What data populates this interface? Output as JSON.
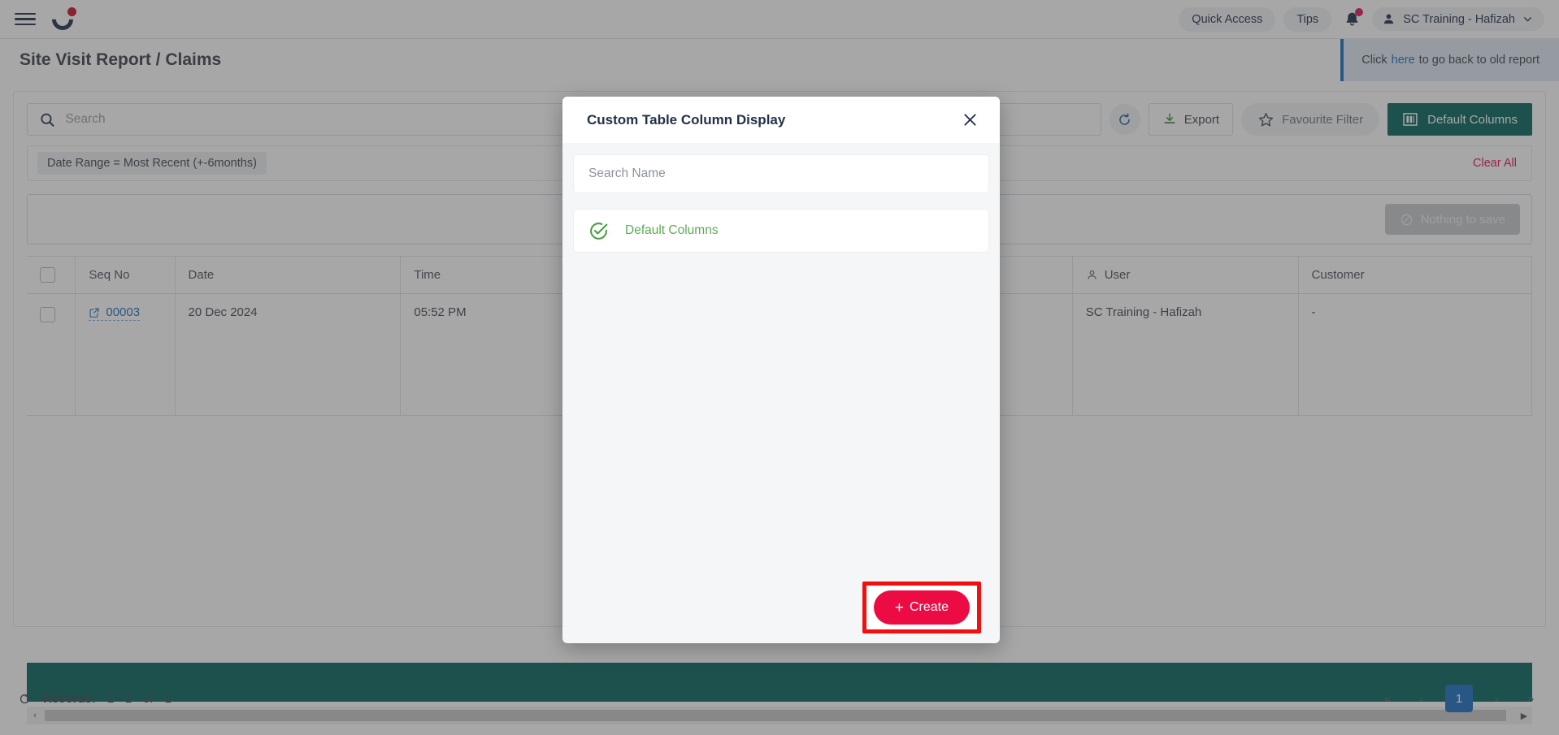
{
  "appbar": {
    "menu_icon": "hamburger-menu-icon",
    "logo_icon": "brand-logo-icon",
    "quick_access_label": "Quick Access",
    "tips_label": "Tips",
    "notifications_icon": "bell-icon",
    "user_name": "SC Training - Hafizah",
    "user_icon": "person-icon",
    "chevron_icon": "chevron-down-icon"
  },
  "header": {
    "page_title": "Site Visit Report / Claims",
    "banner_prefix": "Click",
    "banner_link": "here",
    "banner_suffix": "to go back to old report"
  },
  "toolbar": {
    "search_placeholder": "Search",
    "search_value": "",
    "search_icon": "search-icon",
    "refresh_icon": "refresh-icon",
    "export_label": "Export",
    "export_icon": "download-icon",
    "favourite_filter_label": "Favourite Filter",
    "favourite_filter_icon": "star-icon",
    "default_columns_label": "Default Columns",
    "default_columns_icon": "columns-icon"
  },
  "filters": {
    "chip_label": "Date Range  =  Most Recent (+-6months)",
    "clear_all_label": "Clear All"
  },
  "savebar": {
    "nothing_to_save_label": "Nothing to save",
    "nothing_to_save_icon": "no-entry-icon"
  },
  "table": {
    "columns": [
      {
        "label": "Seq No",
        "icon": ""
      },
      {
        "label": "Date",
        "icon": ""
      },
      {
        "label": "Time",
        "icon": ""
      },
      {
        "label": "User",
        "icon": "person-icon"
      },
      {
        "label": "Customer",
        "icon": ""
      }
    ],
    "rows": [
      {
        "seq_no": "00003",
        "seq_icon": "external-link-icon",
        "date": "20 Dec 2024",
        "time": "05:52 PM",
        "user": "SC Training - Hafizah",
        "customer": "-"
      }
    ]
  },
  "footer": {
    "refresh_icon": "refresh-icon",
    "records_label": "Records:",
    "records_range": "1 - 1",
    "records_of": "of",
    "records_total": "1",
    "pager": {
      "first": "«",
      "prev": "‹",
      "current": "1",
      "next": "›",
      "last": "»"
    },
    "scroll_left_icon": "scroll-left-arrow-icon",
    "scroll_right_icon": "scroll-right-arrow-icon"
  },
  "modal": {
    "title": "Custom Table Column Display",
    "close_icon": "close-icon",
    "search_placeholder": "Search Name",
    "search_value": "",
    "items": [
      {
        "label": "Default Columns",
        "icon": "check-circle-icon",
        "selected": true
      }
    ],
    "create_label": "Create",
    "create_plus": "+"
  },
  "colors": {
    "brand_navy": "#22314a",
    "brand_crimson": "#c8102e",
    "teal": "#05635c",
    "link_blue": "#1b6ec2",
    "pink": "#ec0b43",
    "green": "#5eab55",
    "highlight_red": "#f20f0f"
  }
}
